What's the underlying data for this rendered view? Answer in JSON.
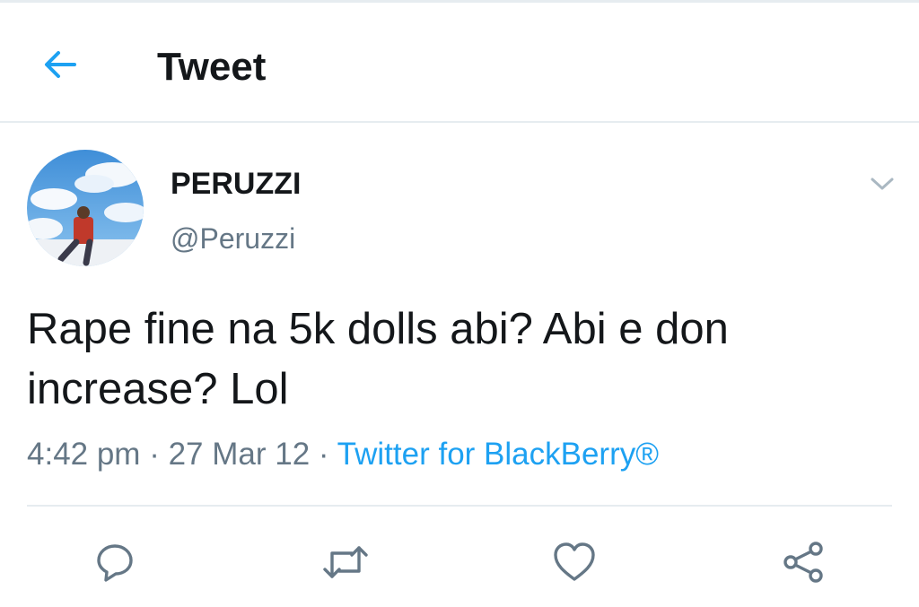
{
  "header": {
    "title": "Tweet",
    "back_icon": "arrow-left-icon",
    "accent_color": "#1da1f2"
  },
  "tweet": {
    "author": {
      "display_name": "PERUZZI",
      "handle": "@Peruzzi",
      "avatar_icon": "avatar-photo"
    },
    "text": "Rape fine na 5k dolls abi? Abi e don increase? Lol",
    "time": "4:42 pm",
    "separator": "·",
    "date": "27 Mar 12",
    "source": "Twitter for BlackBerry®",
    "menu_icon": "chevron-down-icon"
  },
  "actions": {
    "reply_icon": "reply-icon",
    "retweet_icon": "retweet-icon",
    "like_icon": "heart-icon",
    "share_icon": "share-icon",
    "icon_color": "#657786"
  },
  "colors": {
    "text_primary": "#14171a",
    "text_secondary": "#657786",
    "link": "#1da1f2",
    "divider": "#e6ecf0"
  }
}
